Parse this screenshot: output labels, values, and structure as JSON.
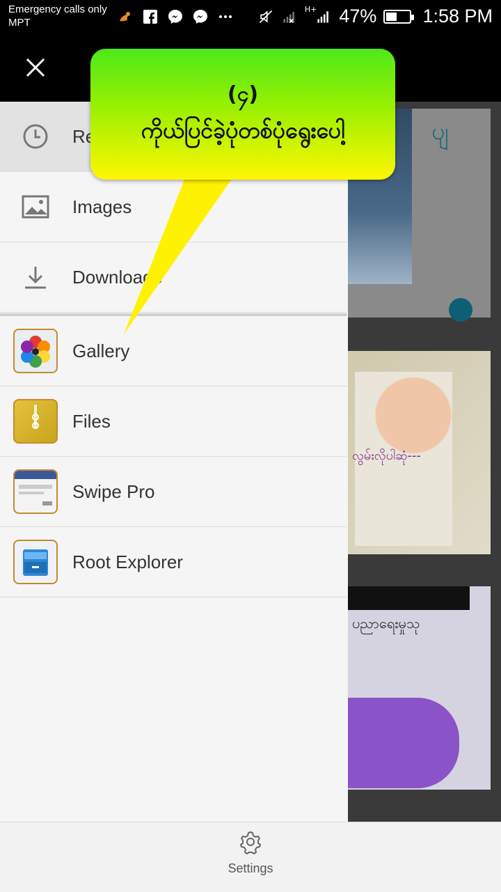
{
  "status_bar": {
    "carrier_line1": "Emergency calls only",
    "carrier_line2": "MPT",
    "signal": "H+",
    "battery_percent": "47%",
    "battery_level": 0.47,
    "time": "1:58 PM",
    "icons": [
      "uc-browser-icon",
      "facebook-icon",
      "messenger-icon",
      "messenger-icon",
      "more-icon",
      "mute-icon",
      "signal-icon"
    ]
  },
  "drawer": {
    "items": [
      {
        "label": "Re",
        "icon": "clock-icon"
      },
      {
        "label": "Images",
        "icon": "image-icon"
      },
      {
        "label": "Downloads",
        "icon": "download-icon"
      }
    ],
    "apps": [
      {
        "label": "Gallery",
        "icon": "gallery-app-icon"
      },
      {
        "label": "Files",
        "icon": "files-app-icon"
      },
      {
        "label": "Swipe Pro",
        "icon": "swipe-pro-app-icon"
      },
      {
        "label": "Root Explorer",
        "icon": "root-explorer-app-icon"
      }
    ]
  },
  "background": {
    "card1_text": "ပျ",
    "card2_text": "လွမ်းလိုပါဆုံ---",
    "card3_text": "ပညာရေးမှုသု"
  },
  "bottom_bar": {
    "settings_label": "Settings"
  },
  "callout": {
    "line1": "(၄)",
    "line2": "ကိုယ်ပြင်ခဲ့ပုံတစ်ပုံရွေးပေါ့"
  },
  "colors": {
    "callout_top": "#4ee81a",
    "callout_bottom": "#fff700",
    "drawer_bg": "#f5f5f5",
    "icon_gray": "#777777"
  }
}
